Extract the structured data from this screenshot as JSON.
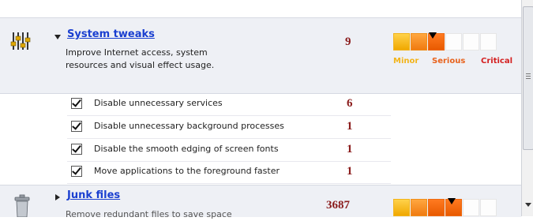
{
  "groups": [
    {
      "title": "System tweaks",
      "description_line1": "Improve Internet access, system",
      "description_line2": "resources and visual effect usage.",
      "count": "9",
      "icon": "equalizer-sliders-icon",
      "expanded": true,
      "severity_fraction": 0.45
    },
    {
      "title": "Junk files",
      "description_partial": "Remove redundant files to save space",
      "count": "3687",
      "icon": "trash-bin-icon",
      "expanded": false,
      "severity_fraction": 0.65
    }
  ],
  "severity_scale": {
    "minor": "Minor",
    "serious": "Serious",
    "critical": "Critical",
    "colors": {
      "minor": "#f2b41a",
      "serious": "#e8621c",
      "critical": "#d42020"
    }
  },
  "tweaks": [
    {
      "label": "Disable unnecessary services",
      "count": "6",
      "checked": true
    },
    {
      "label": "Disable unnecessary background processes",
      "count": "1",
      "checked": true
    },
    {
      "label": "Disable the smooth edging of screen fonts",
      "count": "1",
      "checked": true
    },
    {
      "label": "Move applications to the foreground faster",
      "count": "1",
      "checked": true
    }
  ]
}
